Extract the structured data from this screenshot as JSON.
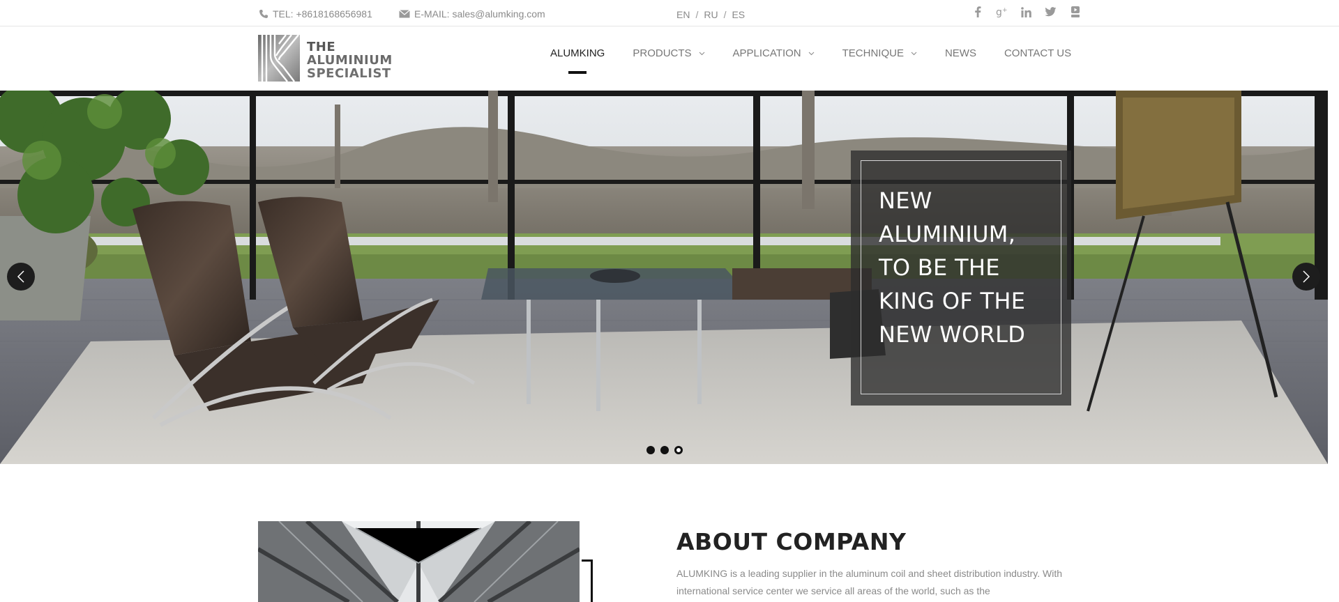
{
  "topbar": {
    "tel": "TEL: +8618168656981",
    "email": "E-MAIL: sales@alumking.com",
    "languages": [
      "EN",
      "RU",
      "ES"
    ],
    "lang_separator": "/",
    "social_icons": [
      "facebook-icon",
      "google-plus-icon",
      "linkedin-icon",
      "twitter-icon",
      "youtube-icon"
    ]
  },
  "logo": {
    "line1": "THE",
    "line2": "ALUMINIUM",
    "line3": "SPECIALIST"
  },
  "nav": {
    "items": [
      {
        "label": "ALUMKING",
        "active": true,
        "dropdown": false
      },
      {
        "label": "PRODUCTS",
        "active": false,
        "dropdown": true
      },
      {
        "label": "APPLICATION",
        "active": false,
        "dropdown": true
      },
      {
        "label": "TECHNIQUE",
        "active": false,
        "dropdown": true
      },
      {
        "label": "NEWS",
        "active": false,
        "dropdown": false
      },
      {
        "label": "CONTACT US",
        "active": false,
        "dropdown": false
      }
    ]
  },
  "hero": {
    "caption": "NEW\nALUMINIUM,\nTO BE THE\nKING OF THE\nNEW WORLD",
    "slides": 3,
    "active_slide": 3
  },
  "about": {
    "title": "ABOUT COMPANY",
    "text": "ALUMKING is a leading supplier in the aluminum coil and sheet distribution industry. With international service center we service all areas of the world, such as the"
  },
  "colors": {
    "accent": "#111111",
    "muted_text": "#8a8a8a"
  }
}
